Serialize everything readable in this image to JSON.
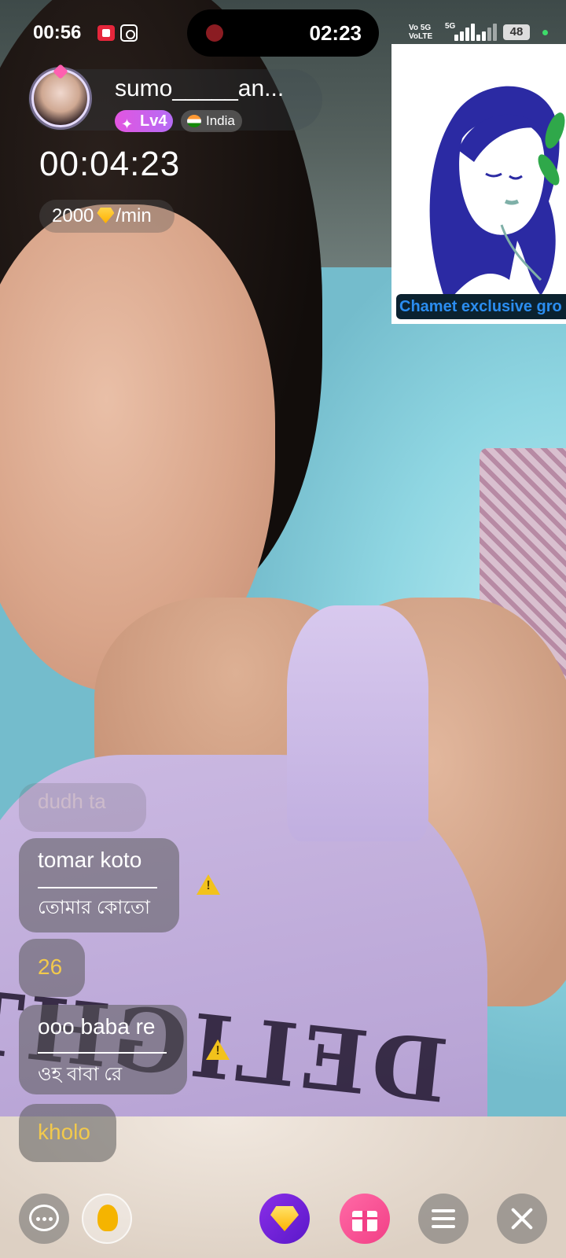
{
  "status_bar": {
    "time": "00:56",
    "network_label_1": "Vo 5G",
    "network_label_2": "VoLTE",
    "network_type": "5G",
    "battery": "48"
  },
  "recording": {
    "elapsed": "02:23"
  },
  "host": {
    "name": "sumo_____an...",
    "level": "Lv4",
    "country": "India"
  },
  "call": {
    "timer": "00:04:23",
    "rate_value": "2000",
    "rate_unit": "/min"
  },
  "ad": {
    "label": "Chamet exclusive gro"
  },
  "chat": {
    "faded_message": "dudh ta",
    "messages": [
      {
        "text": "tomar koto",
        "translation": "তোমার কোতো"
      },
      {
        "text": "26"
      },
      {
        "text": "ooo baba re",
        "translation": "ওহ বাবা রে"
      },
      {
        "text": "kholo"
      }
    ]
  },
  "background_text": "DELIGHT",
  "colors": {
    "level_badge": "#e255e0",
    "gem": "#ffc107",
    "gift_button": "#f23f86",
    "gem_button": "#7a26e0",
    "warning": "#f2c21b",
    "highlight_text": "#f2c94c"
  },
  "icons": {
    "chat": "chat-bubble-icon",
    "tip": "lightbulb-icon",
    "recharge": "diamond-icon",
    "gift": "gift-icon",
    "menu": "menu-icon",
    "close": "close-icon"
  }
}
